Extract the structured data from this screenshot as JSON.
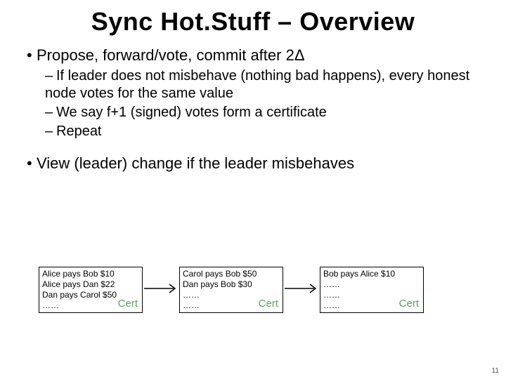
{
  "title": "Sync Hot.Stuff – Overview",
  "bullets": {
    "b1a": "Propose, forward/vote, commit after 2Δ",
    "b2a": "If leader does not misbehave (nothing bad happens), every honest node votes for the same value",
    "b2b": "We say f+1 (signed) votes form a certificate",
    "b2c": "Repeat",
    "b1b": "View (leader) change if the leader misbehaves"
  },
  "blocks": [
    {
      "lines": [
        "Alice pays Bob $10",
        "Alice pays Dan $22",
        "Dan pays Carol $50",
        "……"
      ],
      "cert": "Cert"
    },
    {
      "lines": [
        "Carol pays Bob $50",
        "Dan pays Bob $30",
        "……",
        "……"
      ],
      "cert": "Cert"
    },
    {
      "lines": [
        "Bob pays Alice $10",
        "……",
        "……",
        "……"
      ],
      "cert": "Cert"
    }
  ],
  "page_number": "11",
  "glyphs": {
    "bullet": "•",
    "dash": "–"
  }
}
